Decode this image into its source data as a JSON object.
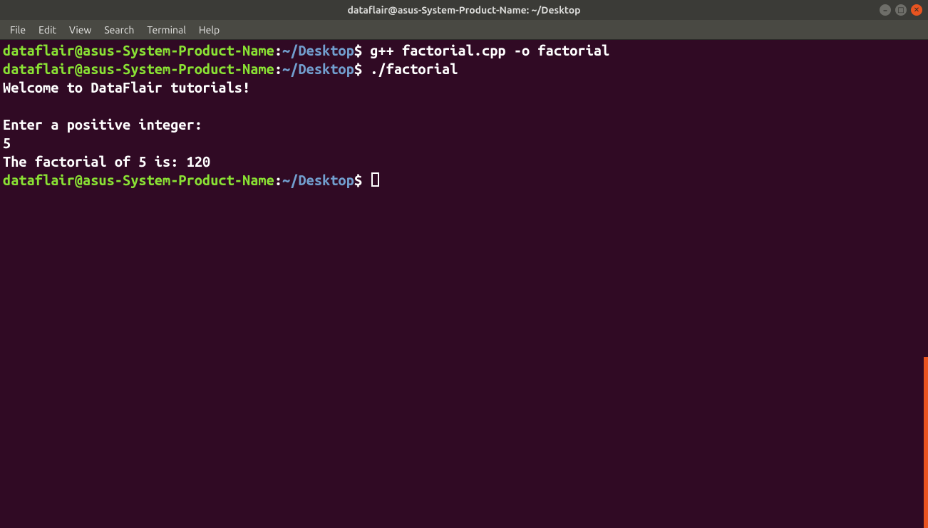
{
  "window": {
    "title": "dataflair@asus-System-Product-Name: ~/Desktop"
  },
  "menubar": {
    "items": [
      "File",
      "Edit",
      "View",
      "Search",
      "Terminal",
      "Help"
    ]
  },
  "prompt": {
    "user_host": "dataflair@asus-System-Product-Name",
    "colon": ":",
    "path": "~/Desktop",
    "dollar": "$"
  },
  "lines": [
    {
      "type": "prompt",
      "cmd": " g++ factorial.cpp -o factorial"
    },
    {
      "type": "prompt",
      "cmd": " ./factorial"
    },
    {
      "type": "output",
      "text": "Welcome to DataFlair tutorials!"
    },
    {
      "type": "blank"
    },
    {
      "type": "output",
      "text": "Enter a positive integer: "
    },
    {
      "type": "output",
      "text": "5"
    },
    {
      "type": "output",
      "text": "The factorial of 5 is: 120"
    },
    {
      "type": "prompt_cursor",
      "cmd": " "
    }
  ]
}
